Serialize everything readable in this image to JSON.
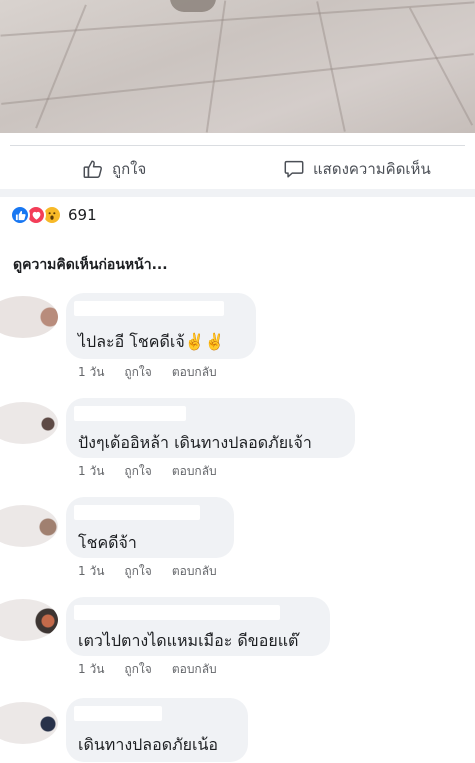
{
  "actions": {
    "like_label": "ถูกใจ",
    "comment_label": "แสดงความคิดเห็น"
  },
  "reactions": {
    "icons": [
      "like-reaction-icon",
      "love-reaction-icon",
      "wow-reaction-icon"
    ],
    "count": "691"
  },
  "view_previous": "ดูความคิดเห็นก่อนหน้า...",
  "comments": [
    {
      "text": "ไปละอี โชคดีเจ้✌️✌️",
      "time": "1 วัน",
      "like": "ถูกใจ",
      "reply": "ตอบกลับ"
    },
    {
      "text": "ปังๆเด้ออิหล้า เดินทางปลอดภัยเจ้า",
      "time": "1 วัน",
      "like": "ถูกใจ",
      "reply": "ตอบกลับ"
    },
    {
      "text": "โชคดีจ้า",
      "time": "1 วัน",
      "like": "ถูกใจ",
      "reply": "ตอบกลับ"
    },
    {
      "text": "เตวไปตางไดแหมเมือะ ดีขอยแต๊",
      "time": "1 วัน",
      "like": "ถูกใจ",
      "reply": "ตอบกลับ"
    },
    {
      "text": "เดินทางปลอดภัยเน้อ"
    }
  ],
  "colors": {
    "accent": "#1877f2",
    "bubble": "#f0f2f5",
    "meta_text": "#65676b"
  }
}
